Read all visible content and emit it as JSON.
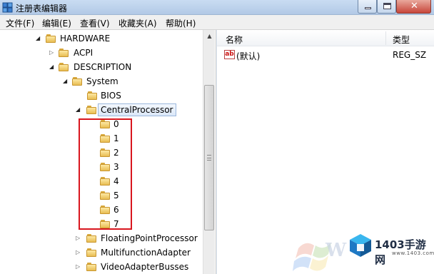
{
  "window": {
    "title": "注册表编辑器",
    "close_glyph": "✕"
  },
  "menu": [
    "文件(F)",
    "编辑(E)",
    "查看(V)",
    "收藏夹(A)",
    "帮助(H)"
  ],
  "tree": {
    "items": [
      {
        "label": "HARDWARE",
        "state": "expanded"
      },
      {
        "label": "ACPI",
        "state": "collapsed"
      },
      {
        "label": "DESCRIPTION",
        "state": "expanded"
      },
      {
        "label": "System",
        "state": "expanded"
      },
      {
        "label": "BIOS",
        "state": "leaf"
      },
      {
        "label": "CentralProcessor",
        "state": "expanded",
        "selected": true
      },
      {
        "label": "0",
        "state": "leaf"
      },
      {
        "label": "1",
        "state": "leaf"
      },
      {
        "label": "2",
        "state": "leaf"
      },
      {
        "label": "3",
        "state": "leaf"
      },
      {
        "label": "4",
        "state": "leaf"
      },
      {
        "label": "5",
        "state": "leaf"
      },
      {
        "label": "6",
        "state": "leaf"
      },
      {
        "label": "7",
        "state": "leaf"
      },
      {
        "label": "FloatingPointProcessor",
        "state": "collapsed"
      },
      {
        "label": "MultifunctionAdapter",
        "state": "collapsed"
      },
      {
        "label": "VideoAdapterBusses",
        "state": "collapsed"
      }
    ]
  },
  "list": {
    "columns": {
      "name": "名称",
      "type": "类型"
    },
    "rows": [
      {
        "icon": "ab",
        "name": "(默认)",
        "type": "REG_SZ"
      }
    ]
  },
  "watermark": {
    "text": "W",
    "site_name": "1403手游网",
    "site_url": "www.1403.com"
  },
  "colors": {
    "highlight_box": "#d9161e",
    "folder": "#f2cf6b",
    "titlebar": "#c4d8f0"
  }
}
